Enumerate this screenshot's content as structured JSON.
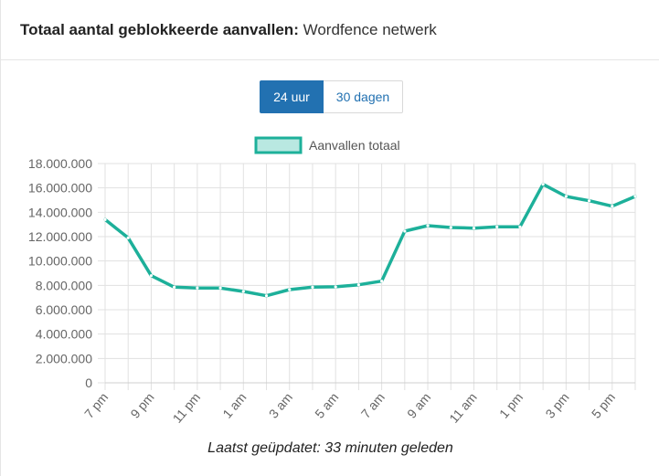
{
  "header": {
    "title_bold": "Totaal aantal geblokkeerde aanvallen:",
    "title_normal": "Wordfence netwerk"
  },
  "toggle": {
    "option_active": "24 uur",
    "option_inactive": "30 dagen"
  },
  "footer": {
    "updated_text": "Laatst geüpdatet: 33 minuten geleden"
  },
  "colors": {
    "line": "#1db09a",
    "legend_fill": "#b9e8e1",
    "grid": "#e1e1e1",
    "button_active": "#2271b1"
  },
  "chart_data": {
    "type": "line",
    "legend_position": "top",
    "grid": true,
    "ylim": [
      0,
      18000000
    ],
    "y_ticks": [
      "0",
      "2.000.000",
      "4.000.000",
      "6.000.000",
      "8.000.000",
      "10.000.000",
      "12.000.000",
      "14.000.000",
      "16.000.000",
      "18.000.000"
    ],
    "x_tick_labels": [
      "7 pm",
      "9 pm",
      "11 pm",
      "1 am",
      "3 am",
      "5 am",
      "7 am",
      "9 am",
      "11 am",
      "1 pm",
      "3 pm",
      "5 pm"
    ],
    "x": [
      "7 pm",
      "8 pm",
      "9 pm",
      "10 pm",
      "11 pm",
      "12 am",
      "1 am",
      "2 am",
      "3 am",
      "4 am",
      "5 am",
      "6 am",
      "7 am",
      "8 am",
      "9 am",
      "10 am",
      "11 am",
      "12 pm",
      "1 pm",
      "2 pm",
      "3 pm",
      "4 pm",
      "5 pm",
      "6 pm"
    ],
    "series": [
      {
        "name": "Aanvallen totaal",
        "values": [
          13400000,
          11900000,
          8800000,
          7850000,
          7780000,
          7780000,
          7500000,
          7150000,
          7650000,
          7850000,
          7880000,
          8050000,
          8350000,
          12450000,
          12900000,
          12750000,
          12700000,
          12800000,
          12800000,
          16300000,
          15300000,
          14950000,
          14500000,
          15300000
        ]
      }
    ]
  }
}
